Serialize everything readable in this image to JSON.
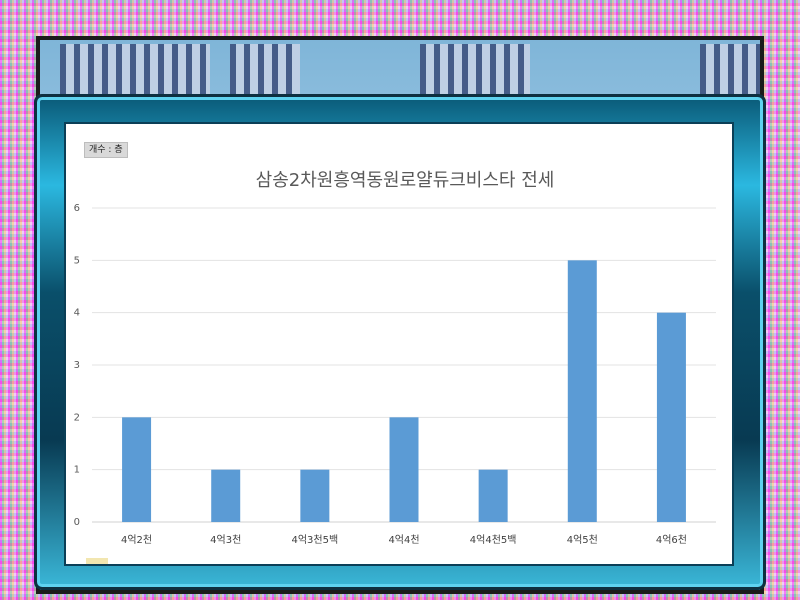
{
  "field_button_label": "개수 : 층",
  "chart_data": {
    "type": "bar",
    "title": "삼송2차원흥역동원로얄듀크비스타 전세",
    "categories": [
      "4억2천",
      "4억3천",
      "4억3천5백",
      "4억4천",
      "4억4천5백",
      "4억5천",
      "4억6천"
    ],
    "values": [
      2,
      1,
      1,
      2,
      1,
      5,
      4
    ],
    "yticks": [
      0,
      1,
      2,
      3,
      4,
      5,
      6
    ],
    "ylim": [
      0,
      6
    ],
    "grid": true,
    "bar_color": "#5b9bd5"
  }
}
